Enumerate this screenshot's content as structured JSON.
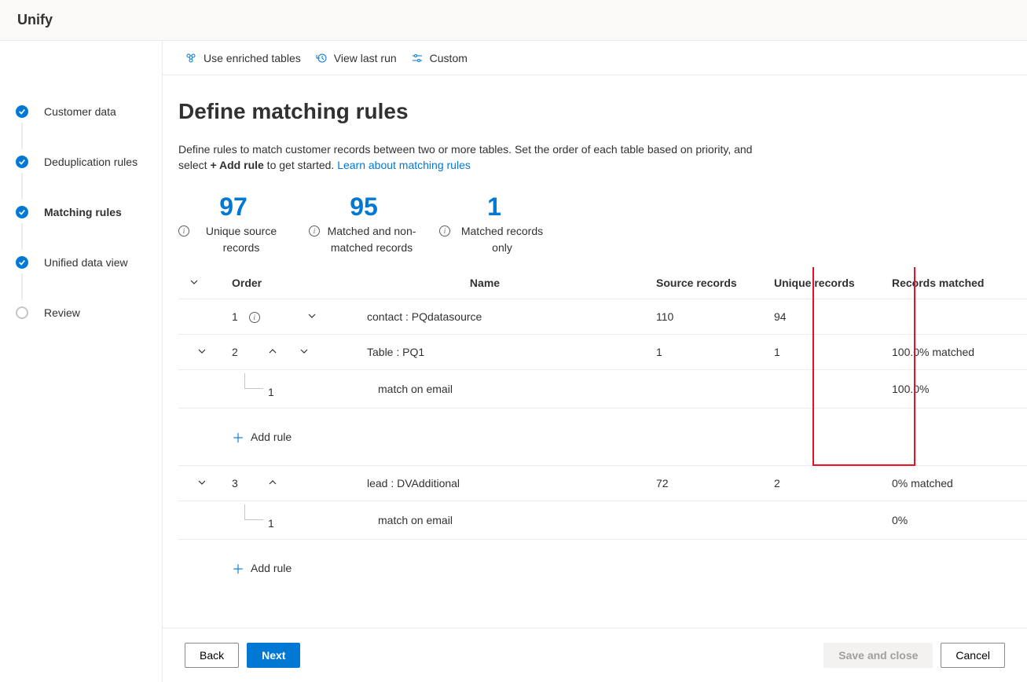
{
  "header": {
    "title": "Unify"
  },
  "sidebar": {
    "steps": [
      {
        "label": "Customer data",
        "state": "done"
      },
      {
        "label": "Deduplication rules",
        "state": "done"
      },
      {
        "label": "Matching rules",
        "state": "done",
        "active": true
      },
      {
        "label": "Unified data view",
        "state": "done"
      },
      {
        "label": "Review",
        "state": "pending"
      }
    ]
  },
  "toolbar": {
    "enriched": "Use enriched tables",
    "lastrun": "View last run",
    "custom": "Custom"
  },
  "page": {
    "title": "Define matching rules",
    "desc_pre": "Define rules to match customer records between two or more tables. Set the order of each table based on priority, and select ",
    "desc_bold": "+ Add rule",
    "desc_post": " to get started. ",
    "learn_link": "Learn about matching rules"
  },
  "stats": [
    {
      "value": "97",
      "label": "Unique source records"
    },
    {
      "value": "95",
      "label": "Matched and non-matched records"
    },
    {
      "value": "1",
      "label": "Matched records only"
    }
  ],
  "table": {
    "headers": {
      "order": "Order",
      "name": "Name",
      "src": "Source records",
      "uniq": "Unique records",
      "match": "Records matched"
    },
    "rows": [
      {
        "order": "1",
        "name": "contact : PQdatasource",
        "src": "110",
        "uniq": "94",
        "match": "",
        "has_info": true
      },
      {
        "order": "2",
        "name": "Table : PQ1",
        "src": "1",
        "uniq": "1",
        "match": "100.0% matched",
        "expandable": true,
        "up": true,
        "down": true,
        "subrule": {
          "order": "1",
          "name": "match on email",
          "match": "100.0%"
        }
      },
      {
        "order": "3",
        "name": "lead : DVAdditional",
        "src": "72",
        "uniq": "2",
        "match": "0% matched",
        "expandable": true,
        "up": true,
        "subrule": {
          "order": "1",
          "name": "match on email",
          "match": "0%"
        }
      }
    ],
    "add_rule": "Add rule"
  },
  "footer": {
    "back": "Back",
    "next": "Next",
    "save": "Save and close",
    "cancel": "Cancel"
  }
}
